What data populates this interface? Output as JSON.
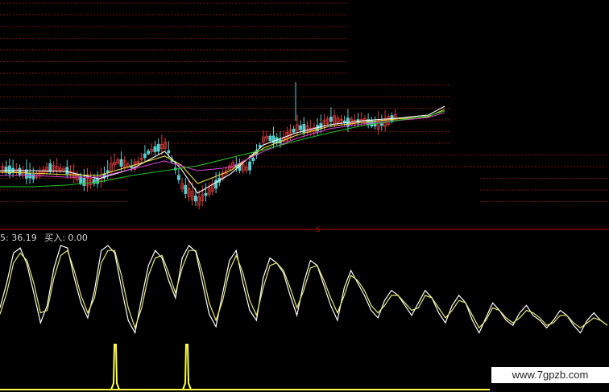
{
  "readout": {
    "prefix": "5: 36.19",
    "buy_label": "买入: 0.00"
  },
  "watermark": "www.7gpzb.com",
  "marker_label": "S",
  "colors": {
    "background": "#000000",
    "grid": "#7a1010",
    "divider": "#b01010",
    "candle_up": "#e03a3a",
    "candle_down": "#55d0d0",
    "ma_white": "#ffffff",
    "ma_yellow": "#f0e040",
    "ma_magenta": "#d040d0",
    "ma_green": "#20c020",
    "kdj_white": "#ffffff",
    "kdj_yellow": "#e8e870",
    "buy_signal": "#ffff40"
  },
  "chart_data": [
    {
      "type": "candlestick",
      "price_trend": [
        [
          0,
          210
        ],
        [
          5,
          212
        ],
        [
          10,
          220
        ],
        [
          15,
          208
        ],
        [
          20,
          212
        ],
        [
          25,
          226
        ],
        [
          30,
          225
        ],
        [
          35,
          200
        ],
        [
          40,
          208
        ],
        [
          45,
          188
        ],
        [
          50,
          180
        ],
        [
          55,
          232
        ],
        [
          60,
          250
        ],
        [
          65,
          230
        ],
        [
          70,
          205
        ],
        [
          75,
          210
        ],
        [
          80,
          170
        ],
        [
          85,
          176
        ],
        [
          90,
          158
        ],
        [
          95,
          162
        ],
        [
          100,
          148
        ],
        [
          105,
          152
        ],
        [
          110,
          150
        ],
        [
          115,
          156
        ],
        [
          120,
          144
        ],
        [
          125,
          148
        ],
        [
          130,
          150
        ],
        [
          135,
          128
        ]
      ],
      "moving_averages": [
        {
          "color_key": "ma_white",
          "points": [
            [
              0,
              212
            ],
            [
              10,
              212
            ],
            [
              20,
              213
            ],
            [
              30,
              222
            ],
            [
              40,
              210
            ],
            [
              50,
              188
            ],
            [
              55,
              210
            ],
            [
              60,
              240
            ],
            [
              70,
              216
            ],
            [
              80,
              180
            ],
            [
              90,
              165
            ],
            [
              100,
              155
            ],
            [
              110,
              150
            ],
            [
              120,
              147
            ],
            [
              130,
              143
            ],
            [
              135,
              132
            ]
          ]
        },
        {
          "color_key": "ma_yellow",
          "points": [
            [
              0,
              214
            ],
            [
              10,
              215
            ],
            [
              20,
              217
            ],
            [
              30,
              218
            ],
            [
              40,
              206
            ],
            [
              50,
              194
            ],
            [
              55,
              205
            ],
            [
              60,
              228
            ],
            [
              70,
              212
            ],
            [
              80,
              184
            ],
            [
              90,
              168
            ],
            [
              100,
              157
            ],
            [
              110,
              152
            ],
            [
              120,
              148
            ],
            [
              130,
              145
            ],
            [
              135,
              136
            ]
          ]
        },
        {
          "color_key": "ma_magenta",
          "points": [
            [
              0,
              218
            ],
            [
              10,
              218
            ],
            [
              20,
              220
            ],
            [
              30,
              220
            ],
            [
              40,
              210
            ],
            [
              50,
              200
            ],
            [
              60,
              212
            ],
            [
              70,
              208
            ],
            [
              80,
              188
            ],
            [
              90,
              172
            ],
            [
              100,
              160
            ],
            [
              110,
              154
            ],
            [
              120,
              150
            ],
            [
              130,
              146
            ],
            [
              135,
              140
            ]
          ]
        },
        {
          "color_key": "ma_green",
          "points": [
            [
              0,
              232
            ],
            [
              10,
              232
            ],
            [
              20,
              230
            ],
            [
              30,
              226
            ],
            [
              40,
              218
            ],
            [
              50,
              212
            ],
            [
              60,
              206
            ],
            [
              70,
              196
            ],
            [
              80,
              186
            ],
            [
              90,
              175
            ],
            [
              100,
              165
            ],
            [
              110,
              156
            ],
            [
              120,
              150
            ],
            [
              130,
              144
            ],
            [
              135,
              138
            ]
          ]
        }
      ]
    },
    {
      "type": "line",
      "series": [
        {
          "color_key": "kdj_white",
          "values": [
            50,
            70,
            94,
            98,
            85,
            62,
            38,
            52,
            82,
            100,
            98,
            74,
            54,
            42,
            64,
            96,
            100,
            94,
            66,
            40,
            30,
            58,
            84,
            96,
            90,
            72,
            58,
            90,
            100,
            95,
            70,
            45,
            35,
            62,
            88,
            96,
            70,
            48,
            40,
            74,
            90,
            86,
            78,
            60,
            44,
            70,
            88,
            84,
            68,
            52,
            40,
            66,
            80,
            70,
            60,
            48,
            42,
            56,
            64,
            60,
            52,
            44,
            54,
            64,
            58,
            46,
            38,
            52,
            60,
            54,
            40,
            30,
            42,
            54,
            48,
            40,
            36,
            46,
            52,
            44,
            40,
            34,
            40,
            48,
            44,
            36,
            30,
            40,
            46,
            40,
            36
          ]
        },
        {
          "color_key": "kdj_yellow",
          "values": [
            45,
            62,
            86,
            94,
            88,
            70,
            46,
            48,
            74,
            92,
            96,
            80,
            60,
            46,
            58,
            86,
            96,
            96,
            76,
            50,
            34,
            50,
            76,
            90,
            92,
            78,
            62,
            82,
            96,
            96,
            78,
            54,
            40,
            56,
            80,
            92,
            78,
            56,
            44,
            66,
            84,
            86,
            80,
            66,
            50,
            64,
            82,
            84,
            72,
            58,
            46,
            60,
            76,
            72,
            64,
            52,
            46,
            52,
            60,
            60,
            54,
            48,
            50,
            60,
            58,
            50,
            42,
            48,
            56,
            54,
            44,
            34,
            40,
            50,
            48,
            42,
            38,
            42,
            48,
            46,
            42,
            36,
            38,
            44,
            44,
            38,
            34,
            38,
            42,
            40,
            36
          ]
        }
      ],
      "buy_signals": [
        {
          "x": 143,
          "value": 1
        },
        {
          "x": 232,
          "value": 1
        }
      ]
    }
  ]
}
